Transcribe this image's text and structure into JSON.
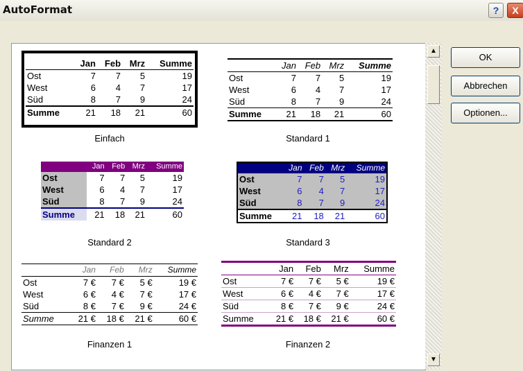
{
  "window": {
    "title": "AutoFormat",
    "help_icon": "?",
    "close_icon": "X"
  },
  "buttons": {
    "ok": "OK",
    "cancel": "Abbrechen",
    "options": "Optionen..."
  },
  "scrollbar": {
    "up": "▲",
    "down": "▼"
  },
  "formats": [
    {
      "caption": "Einfach",
      "header": [
        "",
        "Jan",
        "Feb",
        "Mrz",
        "Summe"
      ],
      "rows": [
        [
          "Ost",
          "7",
          "7",
          "5",
          "19"
        ],
        [
          "West",
          "6",
          "4",
          "7",
          "17"
        ],
        [
          "Süd",
          "8",
          "7",
          "9",
          "24"
        ]
      ],
      "total": [
        "Summe",
        "21",
        "18",
        "21",
        "60"
      ]
    },
    {
      "caption": "Standard 1",
      "header": [
        "",
        "Jan",
        "Feb",
        "Mrz",
        "Summe"
      ],
      "rows": [
        [
          "Ost",
          "7",
          "7",
          "5",
          "19"
        ],
        [
          "West",
          "6",
          "4",
          "7",
          "17"
        ],
        [
          "Süd",
          "8",
          "7",
          "9",
          "24"
        ]
      ],
      "total": [
        "Summe",
        "21",
        "18",
        "21",
        "60"
      ]
    },
    {
      "caption": "Standard 2",
      "header": [
        "",
        "Jan",
        "Feb",
        "Mrz",
        "Summe"
      ],
      "rows": [
        [
          "Ost",
          "7",
          "7",
          "5",
          "19"
        ],
        [
          "West",
          "6",
          "4",
          "7",
          "17"
        ],
        [
          "Süd",
          "8",
          "7",
          "9",
          "24"
        ]
      ],
      "total": [
        "Summe",
        "21",
        "18",
        "21",
        "60"
      ]
    },
    {
      "caption": "Standard 3",
      "header": [
        "",
        "Jan",
        "Feb",
        "Mrz",
        "Summe"
      ],
      "rows": [
        [
          "Ost",
          "7",
          "7",
          "5",
          "19"
        ],
        [
          "West",
          "6",
          "4",
          "7",
          "17"
        ],
        [
          "Süd",
          "8",
          "7",
          "9",
          "24"
        ]
      ],
      "total": [
        "Summe",
        "21",
        "18",
        "21",
        "60"
      ]
    },
    {
      "caption": "Finanzen 1",
      "header": [
        "",
        "Jan",
        "Feb",
        "Mrz",
        "Summe"
      ],
      "rows": [
        [
          "Ost",
          "7 €",
          "7 €",
          "5 €",
          "19 €"
        ],
        [
          "West",
          "6 €",
          "4 €",
          "7 €",
          "17 €"
        ],
        [
          "Süd",
          "8 €",
          "7 €",
          "9 €",
          "24 €"
        ]
      ],
      "total": [
        "Summe",
        "21 €",
        "18 €",
        "21 €",
        "60 €"
      ]
    },
    {
      "caption": "Finanzen 2",
      "header": [
        "",
        "Jan",
        "Feb",
        "Mrz",
        "Summe"
      ],
      "rows": [
        [
          "Ost",
          "7 €",
          "7 €",
          "5 €",
          "19 €"
        ],
        [
          "West",
          "6 €",
          "4 €",
          "7 €",
          "17 €"
        ],
        [
          "Süd",
          "8 €",
          "7 €",
          "9 €",
          "24 €"
        ]
      ],
      "total": [
        "Summe",
        "21 €",
        "18 €",
        "21 €",
        "60 €"
      ]
    }
  ],
  "colors": {
    "purple": "#800080",
    "navy": "#000080",
    "blue_text": "#2020c0",
    "gray": "#c0c0c0"
  }
}
